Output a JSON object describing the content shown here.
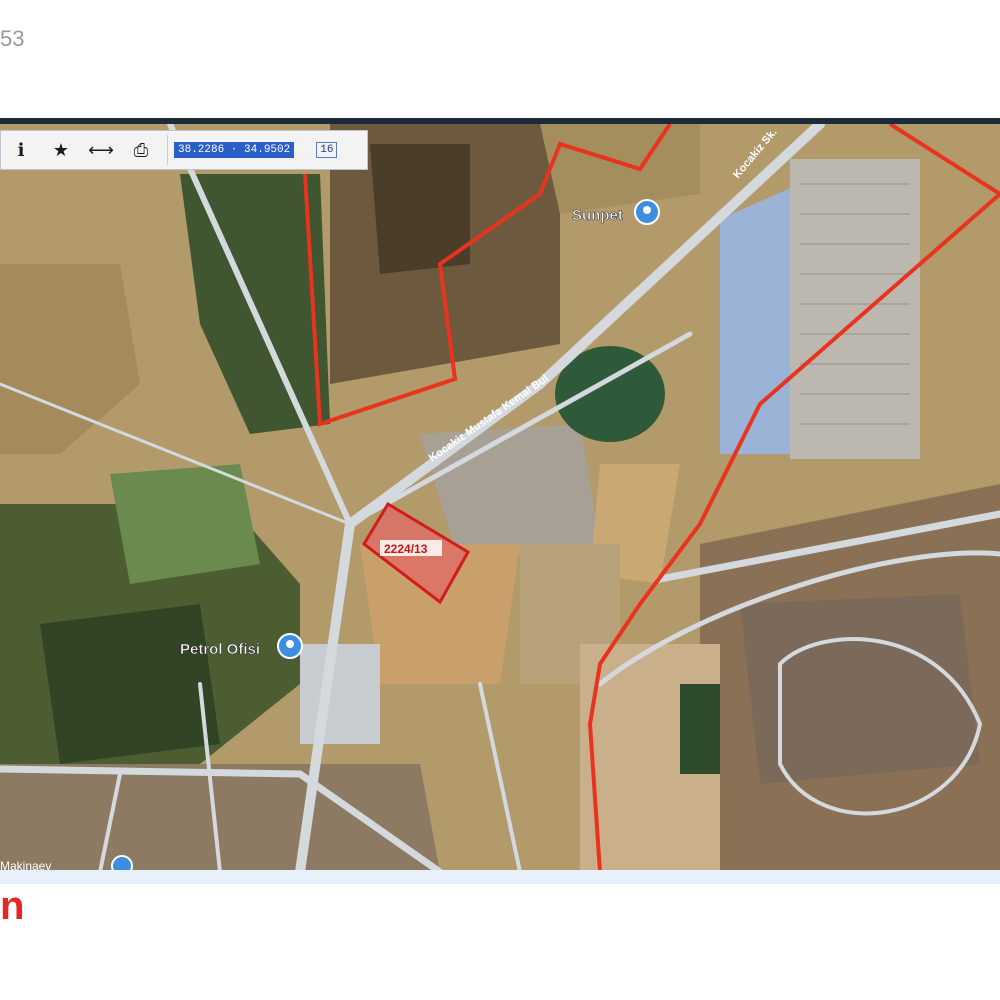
{
  "page": {
    "corner_text": "53"
  },
  "toolbar": {
    "info_icon": "info-icon",
    "star_icon": "star-icon",
    "measure_icon": "measure-icon",
    "print_icon": "printer-icon",
    "coordinates": "38.2286 · 34.9502",
    "zoom_level": "16"
  },
  "map": {
    "labels": {
      "sunpet": "Sunpet",
      "petrol": "Petrol Ofisi",
      "road": "Kocakiz Mustafa Kemal Bul",
      "parcel": "2224/13",
      "road_top": "Kocakiz Sk.",
      "bottom_left": "Makinaev"
    },
    "colors": {
      "boundary": "#e8331f",
      "parcel_fill": "#e06a66",
      "road": "#d4d9de",
      "pin": "#3d8ee0"
    }
  },
  "brand": {
    "text": "n"
  }
}
